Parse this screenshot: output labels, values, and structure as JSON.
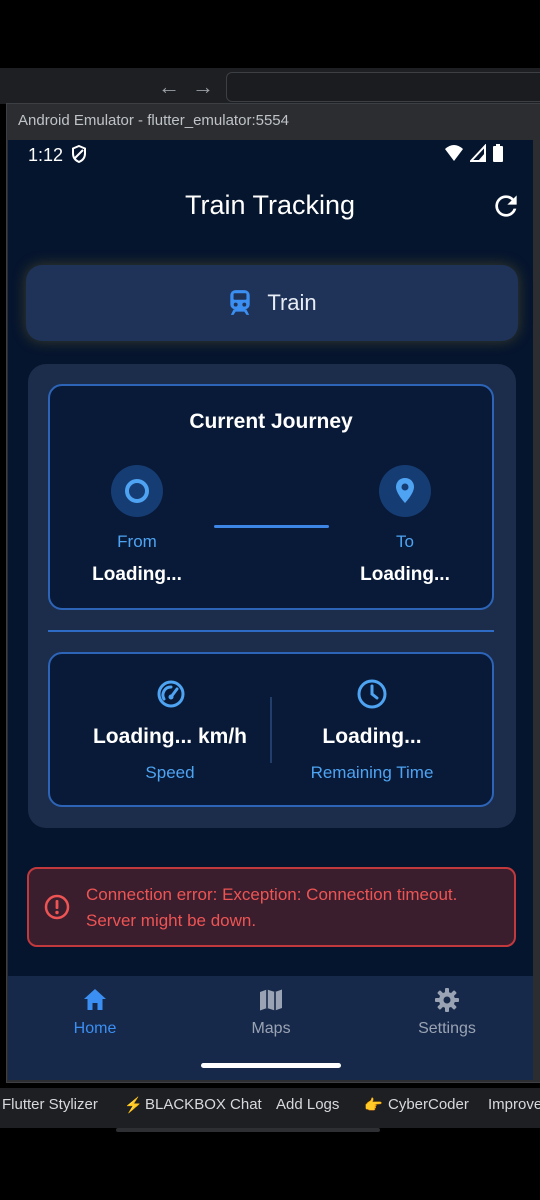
{
  "ide": {
    "back_arrow": "←",
    "forward_arrow": "→",
    "emulator_title": "Android Emulator - flutter_emulator:5554"
  },
  "status_bar": {
    "time": "1:12",
    "icons": [
      "shield-icon",
      "wifi-icon",
      "signal-icon",
      "battery-icon"
    ]
  },
  "app_bar": {
    "title": "Train Tracking",
    "action_icon": "refresh-icon"
  },
  "train_button": {
    "label": "Train",
    "icon": "train-icon"
  },
  "journey": {
    "title": "Current Journey",
    "from_label": "From",
    "from_value": "Loading...",
    "to_label": "To",
    "to_value": "Loading..."
  },
  "stats": {
    "speed_value": "Loading... km/h",
    "speed_label": "Speed",
    "time_value": "Loading...",
    "time_label": "Remaining Time"
  },
  "error": {
    "message": "Connection error: Exception: Connection timeout. Server might be down."
  },
  "bottom_nav": {
    "items": [
      {
        "label": "Home",
        "icon": "home-icon",
        "active": true
      },
      {
        "label": "Maps",
        "icon": "map-icon",
        "active": false
      },
      {
        "label": "Settings",
        "icon": "gear-icon",
        "active": false
      }
    ]
  },
  "taskbar": {
    "items": [
      "Flutter Stylizer",
      "BLACKBOX Chat",
      "Add Logs",
      "CyberCoder",
      "Improve"
    ]
  },
  "colors": {
    "accent": "#3b8ff2",
    "background": "#06152e",
    "card_border": "#2d64b8",
    "error": "#ee5454"
  }
}
